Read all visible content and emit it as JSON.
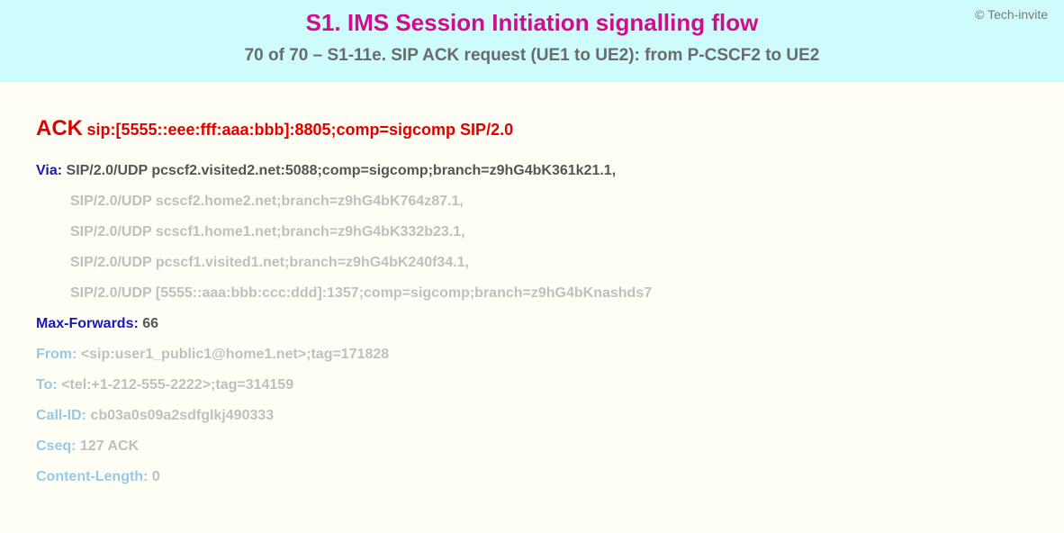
{
  "copyright": "© Tech-invite",
  "title": "S1. IMS Session Initiation signalling flow",
  "subtitle": "70 of 70 – S1-11e. SIP ACK request (UE1 to UE2): from P-CSCF2 to UE2",
  "sip": {
    "method": "ACK",
    "request_uri": "sip:[5555::eee:fff:aaa:bbb]:8805;comp=sigcomp SIP/2.0",
    "via_label": "Via:",
    "via_first": "SIP/2.0/UDP pcscf2.visited2.net:5088;comp=sigcomp;branch=z9hG4bK361k21.1,",
    "via_rest": [
      "SIP/2.0/UDP scscf2.home2.net;branch=z9hG4bK764z87.1,",
      "SIP/2.0/UDP scscf1.home1.net;branch=z9hG4bK332b23.1,",
      "SIP/2.0/UDP pcscf1.visited1.net;branch=z9hG4bK240f34.1,",
      "SIP/2.0/UDP [5555::aaa:bbb:ccc:ddd]:1357;comp=sigcomp;branch=z9hG4bKnashds7"
    ],
    "max_forwards_label": "Max-Forwards:",
    "max_forwards_value": "66",
    "from_label": "From:",
    "from_value": "<sip:user1_public1@home1.net>;tag=171828",
    "to_label": "To:",
    "to_value": "<tel:+1-212-555-2222>;tag=314159",
    "call_id_label": "Call-ID:",
    "call_id_value": "cb03a0s09a2sdfglkj490333",
    "cseq_label": "Cseq:",
    "cseq_value": "127 ACK",
    "content_length_label": "Content-Length:",
    "content_length_value": "0"
  }
}
